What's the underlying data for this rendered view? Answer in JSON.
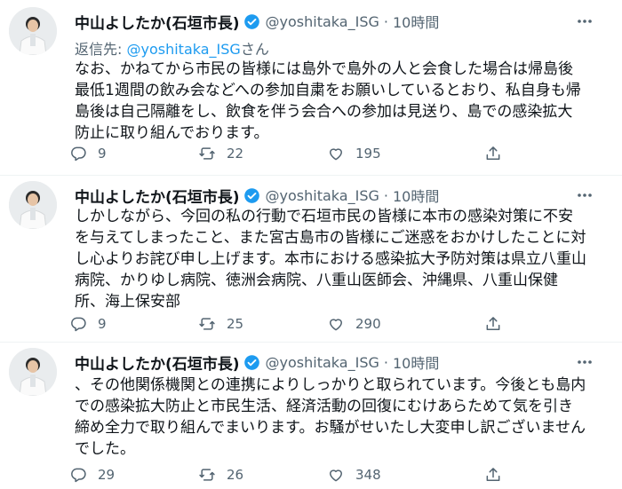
{
  "tweets": [
    {
      "name": "中山よしたか(石垣市長)",
      "handle": "@yoshitaka_ISG",
      "dot": "·",
      "time": "10時間",
      "reply_prefix": "返信先: ",
      "reply_handle": "@yoshitaka_ISG",
      "reply_suffix": "さん",
      "lines": [
        "なお、かねてから市民の皆様には島外で島外の人と会食した場合は帰島後",
        "最低1週間の飲み会などへの参加自粛をお願いしているとおり、私自身も帰",
        "島後は自己隔離をし、飲食を伴う会合への参加は見送り、島での感染拡大",
        "防止に取り組んでおります。"
      ],
      "replies": "9",
      "retweets": "22",
      "likes": "195"
    },
    {
      "name": "中山よしたか(石垣市長)",
      "handle": "@yoshitaka_ISG",
      "dot": "·",
      "time": "10時間",
      "lines": [
        "しかしながら、今回の私の行動で石垣市民の皆様に本市の感染対策に不安",
        "を与えてしまったこと、また宮古島市の皆様にご迷惑をおかけしたことに対",
        "し心よりお詫び申し上げます。本市における感染拡大予防対策は県立八重山",
        "病院、かりゆし病院、徳洲会病院、八重山医師会、沖縄県、八重山保健",
        "所、海上保安部"
      ],
      "replies": "9",
      "retweets": "25",
      "likes": "290"
    },
    {
      "name": "中山よしたか(石垣市長)",
      "handle": "@yoshitaka_ISG",
      "dot": "·",
      "time": "10時間",
      "lines": [
        "、その他関係機関との連携によりしっかりと取られています。今後とも島内",
        "での感染拡大防止と市民生活、経済活動の回復にむけあらためて気を引き",
        "締め全力で取り組んでまいります。お騒がせいたし大変申し訳ございません",
        "でした。"
      ],
      "replies": "29",
      "retweets": "26",
      "likes": "348"
    }
  ],
  "icons": {
    "verified": "verified-badge-icon",
    "more": "more-horizontal-icon",
    "reply": "reply-bubble-icon",
    "retweet": "retweet-icon",
    "like": "heart-icon",
    "share": "share-upload-icon"
  },
  "colors": {
    "accent": "#1d9bf0",
    "secondary_text": "#536471",
    "text": "#0f1419"
  }
}
